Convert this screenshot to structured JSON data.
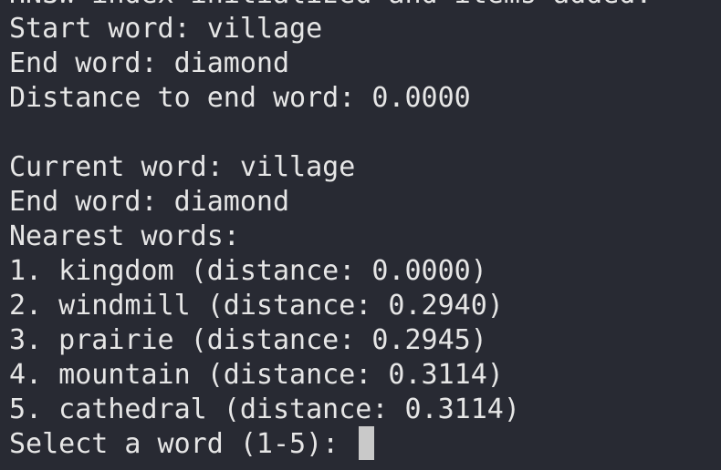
{
  "terminal": {
    "lines": [
      "HNSW index initialized and items added.",
      "Start word: village",
      "End word: diamond",
      "Distance to end word: 0.0000",
      "",
      "Current word: village",
      "End word: diamond",
      "Nearest words:",
      "1. kingdom (distance: 0.0000)",
      "2. windmill (distance: 0.2940)",
      "3. prairie (distance: 0.2945)",
      "4. mountain (distance: 0.3114)",
      "5. cathedral (distance: 0.3114)"
    ],
    "prompt": "Select a word (1-5): "
  },
  "colors": {
    "background": "#282a33",
    "text": "#e6e6e6",
    "cursor": "#c9c9c9"
  }
}
